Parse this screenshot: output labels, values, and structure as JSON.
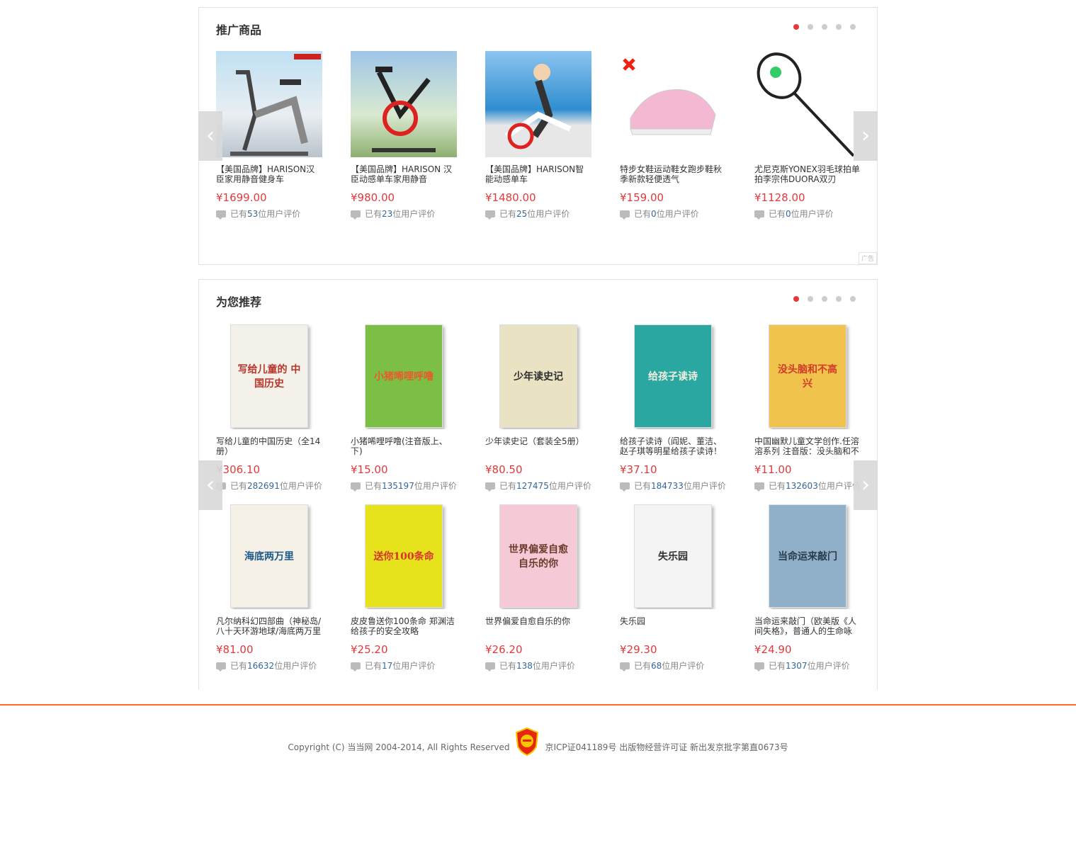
{
  "promo": {
    "title": "推广商品",
    "ad_label": "广告",
    "items": [
      {
        "name": "【美国品牌】HARISON汉臣家用静音健身车",
        "price": "¥1699.00",
        "review_prefix": "已有",
        "review_count": "53",
        "review_suffix": "位用户评价"
      },
      {
        "name": "【美国品牌】HARISON 汉臣动感单车家用静音",
        "price": "¥980.00",
        "review_prefix": "已有",
        "review_count": "23",
        "review_suffix": "位用户评价"
      },
      {
        "name": "【美国品牌】HARISON智能动感单车",
        "price": "¥1480.00",
        "review_prefix": "已有",
        "review_count": "25",
        "review_suffix": "位用户评价"
      },
      {
        "name": "特步女鞋运动鞋女跑步鞋秋季新款轻便透气",
        "price": "¥159.00",
        "review_prefix": "已有",
        "review_count": "0",
        "review_suffix": "位用户评价"
      },
      {
        "name": "尤尼克斯YONEX羽毛球拍单拍李宗伟DUORA双刃",
        "price": "¥1128.00",
        "review_prefix": "已有",
        "review_count": "0",
        "review_suffix": "位用户评价"
      }
    ]
  },
  "recommend": {
    "title": "为您推荐",
    "items": [
      {
        "name": "写给儿童的中国历史（全14册）",
        "price": "¥306.10",
        "review_prefix": "已有",
        "review_count": "282691",
        "review_suffix": "位用户评价",
        "cover": "写给儿童的 中国历史"
      },
      {
        "name": "小猪唏哩呼噜(注音版上、下)",
        "price": "¥15.00",
        "review_prefix": "已有",
        "review_count": "135197",
        "review_suffix": "位用户评价",
        "cover": "小猪唏哩呼噜"
      },
      {
        "name": "少年读史记（套装全5册）",
        "price": "¥80.50",
        "review_prefix": "已有",
        "review_count": "127475",
        "review_suffix": "位用户评价",
        "cover": "少年读史记"
      },
      {
        "name": "给孩子读诗（阎妮、董洁、赵子琪等明星给孩子读诗！",
        "price": "¥37.10",
        "review_prefix": "已有",
        "review_count": "184733",
        "review_suffix": "位用户评价",
        "cover": "给孩子读诗"
      },
      {
        "name": "中国幽默儿童文学创作.任溶溶系列 注音版：没头脑和不",
        "price": "¥11.00",
        "review_prefix": "已有",
        "review_count": "132603",
        "review_suffix": "位用户评价",
        "cover": "没头脑和不高兴"
      },
      {
        "name": "凡尔纳科幻四部曲（神秘岛/八十天环游地球/海底两万里",
        "price": "¥81.00",
        "review_prefix": "已有",
        "review_count": "16632",
        "review_suffix": "位用户评价",
        "cover": "海底两万里"
      },
      {
        "name": "皮皮鲁送你100条命 郑渊洁给孩子的安全攻略",
        "price": "¥25.20",
        "review_prefix": "已有",
        "review_count": "17",
        "review_suffix": "位用户评价",
        "cover": "送你100条命"
      },
      {
        "name": "世界偏爱自愈自乐的你",
        "price": "¥26.20",
        "review_prefix": "已有",
        "review_count": "138",
        "review_suffix": "位用户评价",
        "cover": "世界偏爱自愈自乐的你"
      },
      {
        "name": "失乐园",
        "price": "¥29.30",
        "review_prefix": "已有",
        "review_count": "68",
        "review_suffix": "位用户评价",
        "cover": "失乐园"
      },
      {
        "name": "当命运来敲门（欧美版《人间失格》，普通人的生命咏",
        "price": "¥24.90",
        "review_prefix": "已有",
        "review_count": "1307",
        "review_suffix": "位用户评价",
        "cover": "当命运来敲门"
      }
    ]
  },
  "footer": {
    "copyright": "Copyright (C) 当当网 2004-2014, All Rights Reserved",
    "icp": "京ICP证041189号 出版物经营许可证 新出发京批字第直0673号"
  },
  "colors": {
    "price": "#e4393c",
    "accent": "#ff6a2a",
    "link": "#336699"
  }
}
